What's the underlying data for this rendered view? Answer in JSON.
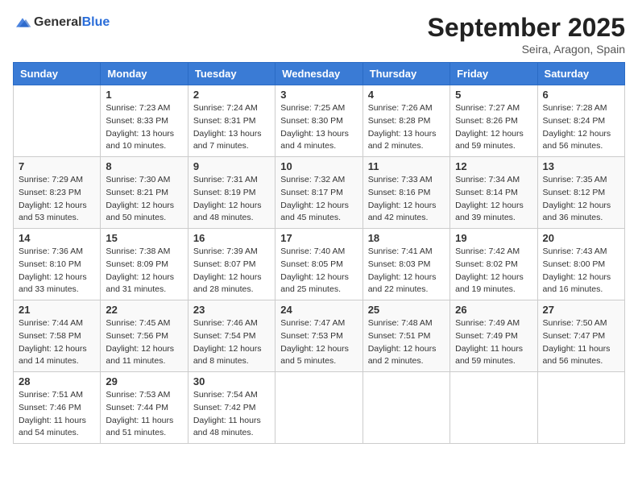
{
  "header": {
    "logo_general": "General",
    "logo_blue": "Blue",
    "month_title": "September 2025",
    "location": "Seira, Aragon, Spain"
  },
  "weekdays": [
    "Sunday",
    "Monday",
    "Tuesday",
    "Wednesday",
    "Thursday",
    "Friday",
    "Saturday"
  ],
  "weeks": [
    [
      {
        "day": "",
        "sunrise": "",
        "sunset": "",
        "daylight": ""
      },
      {
        "day": "1",
        "sunrise": "Sunrise: 7:23 AM",
        "sunset": "Sunset: 8:33 PM",
        "daylight": "Daylight: 13 hours and 10 minutes."
      },
      {
        "day": "2",
        "sunrise": "Sunrise: 7:24 AM",
        "sunset": "Sunset: 8:31 PM",
        "daylight": "Daylight: 13 hours and 7 minutes."
      },
      {
        "day": "3",
        "sunrise": "Sunrise: 7:25 AM",
        "sunset": "Sunset: 8:30 PM",
        "daylight": "Daylight: 13 hours and 4 minutes."
      },
      {
        "day": "4",
        "sunrise": "Sunrise: 7:26 AM",
        "sunset": "Sunset: 8:28 PM",
        "daylight": "Daylight: 13 hours and 2 minutes."
      },
      {
        "day": "5",
        "sunrise": "Sunrise: 7:27 AM",
        "sunset": "Sunset: 8:26 PM",
        "daylight": "Daylight: 12 hours and 59 minutes."
      },
      {
        "day": "6",
        "sunrise": "Sunrise: 7:28 AM",
        "sunset": "Sunset: 8:24 PM",
        "daylight": "Daylight: 12 hours and 56 minutes."
      }
    ],
    [
      {
        "day": "7",
        "sunrise": "Sunrise: 7:29 AM",
        "sunset": "Sunset: 8:23 PM",
        "daylight": "Daylight: 12 hours and 53 minutes."
      },
      {
        "day": "8",
        "sunrise": "Sunrise: 7:30 AM",
        "sunset": "Sunset: 8:21 PM",
        "daylight": "Daylight: 12 hours and 50 minutes."
      },
      {
        "day": "9",
        "sunrise": "Sunrise: 7:31 AM",
        "sunset": "Sunset: 8:19 PM",
        "daylight": "Daylight: 12 hours and 48 minutes."
      },
      {
        "day": "10",
        "sunrise": "Sunrise: 7:32 AM",
        "sunset": "Sunset: 8:17 PM",
        "daylight": "Daylight: 12 hours and 45 minutes."
      },
      {
        "day": "11",
        "sunrise": "Sunrise: 7:33 AM",
        "sunset": "Sunset: 8:16 PM",
        "daylight": "Daylight: 12 hours and 42 minutes."
      },
      {
        "day": "12",
        "sunrise": "Sunrise: 7:34 AM",
        "sunset": "Sunset: 8:14 PM",
        "daylight": "Daylight: 12 hours and 39 minutes."
      },
      {
        "day": "13",
        "sunrise": "Sunrise: 7:35 AM",
        "sunset": "Sunset: 8:12 PM",
        "daylight": "Daylight: 12 hours and 36 minutes."
      }
    ],
    [
      {
        "day": "14",
        "sunrise": "Sunrise: 7:36 AM",
        "sunset": "Sunset: 8:10 PM",
        "daylight": "Daylight: 12 hours and 33 minutes."
      },
      {
        "day": "15",
        "sunrise": "Sunrise: 7:38 AM",
        "sunset": "Sunset: 8:09 PM",
        "daylight": "Daylight: 12 hours and 31 minutes."
      },
      {
        "day": "16",
        "sunrise": "Sunrise: 7:39 AM",
        "sunset": "Sunset: 8:07 PM",
        "daylight": "Daylight: 12 hours and 28 minutes."
      },
      {
        "day": "17",
        "sunrise": "Sunrise: 7:40 AM",
        "sunset": "Sunset: 8:05 PM",
        "daylight": "Daylight: 12 hours and 25 minutes."
      },
      {
        "day": "18",
        "sunrise": "Sunrise: 7:41 AM",
        "sunset": "Sunset: 8:03 PM",
        "daylight": "Daylight: 12 hours and 22 minutes."
      },
      {
        "day": "19",
        "sunrise": "Sunrise: 7:42 AM",
        "sunset": "Sunset: 8:02 PM",
        "daylight": "Daylight: 12 hours and 19 minutes."
      },
      {
        "day": "20",
        "sunrise": "Sunrise: 7:43 AM",
        "sunset": "Sunset: 8:00 PM",
        "daylight": "Daylight: 12 hours and 16 minutes."
      }
    ],
    [
      {
        "day": "21",
        "sunrise": "Sunrise: 7:44 AM",
        "sunset": "Sunset: 7:58 PM",
        "daylight": "Daylight: 12 hours and 14 minutes."
      },
      {
        "day": "22",
        "sunrise": "Sunrise: 7:45 AM",
        "sunset": "Sunset: 7:56 PM",
        "daylight": "Daylight: 12 hours and 11 minutes."
      },
      {
        "day": "23",
        "sunrise": "Sunrise: 7:46 AM",
        "sunset": "Sunset: 7:54 PM",
        "daylight": "Daylight: 12 hours and 8 minutes."
      },
      {
        "day": "24",
        "sunrise": "Sunrise: 7:47 AM",
        "sunset": "Sunset: 7:53 PM",
        "daylight": "Daylight: 12 hours and 5 minutes."
      },
      {
        "day": "25",
        "sunrise": "Sunrise: 7:48 AM",
        "sunset": "Sunset: 7:51 PM",
        "daylight": "Daylight: 12 hours and 2 minutes."
      },
      {
        "day": "26",
        "sunrise": "Sunrise: 7:49 AM",
        "sunset": "Sunset: 7:49 PM",
        "daylight": "Daylight: 11 hours and 59 minutes."
      },
      {
        "day": "27",
        "sunrise": "Sunrise: 7:50 AM",
        "sunset": "Sunset: 7:47 PM",
        "daylight": "Daylight: 11 hours and 56 minutes."
      }
    ],
    [
      {
        "day": "28",
        "sunrise": "Sunrise: 7:51 AM",
        "sunset": "Sunset: 7:46 PM",
        "daylight": "Daylight: 11 hours and 54 minutes."
      },
      {
        "day": "29",
        "sunrise": "Sunrise: 7:53 AM",
        "sunset": "Sunset: 7:44 PM",
        "daylight": "Daylight: 11 hours and 51 minutes."
      },
      {
        "day": "30",
        "sunrise": "Sunrise: 7:54 AM",
        "sunset": "Sunset: 7:42 PM",
        "daylight": "Daylight: 11 hours and 48 minutes."
      },
      {
        "day": "",
        "sunrise": "",
        "sunset": "",
        "daylight": ""
      },
      {
        "day": "",
        "sunrise": "",
        "sunset": "",
        "daylight": ""
      },
      {
        "day": "",
        "sunrise": "",
        "sunset": "",
        "daylight": ""
      },
      {
        "day": "",
        "sunrise": "",
        "sunset": "",
        "daylight": ""
      }
    ]
  ]
}
